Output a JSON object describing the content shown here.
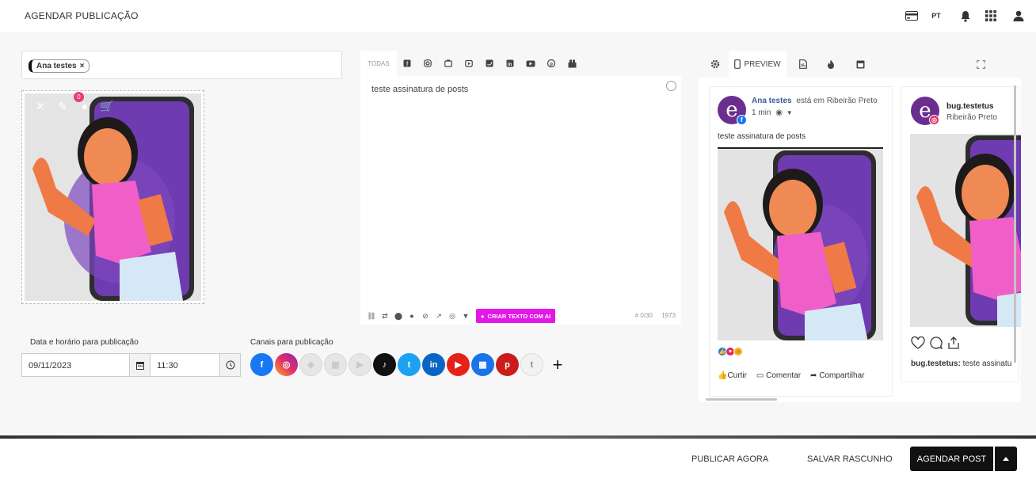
{
  "header": {
    "title": "AGENDAR PUBLICAÇÃO",
    "lang": "PT",
    "icons": [
      "credit-card-icon",
      "bell-icon",
      "apps-grid-icon",
      "user-icon"
    ]
  },
  "profile_tag": {
    "label": "Ana testes",
    "remove": "×"
  },
  "media": {
    "badge_count": "0",
    "tools": [
      "close-icon",
      "brush-icon",
      "person-icon",
      "cart-icon"
    ]
  },
  "schedule": {
    "label": "Data e horário para publicação",
    "date": "09/11/2023",
    "time": "11:30"
  },
  "channels": {
    "label": "Canais para publicação",
    "items": [
      {
        "name": "facebook",
        "glyph": "f",
        "color": "#1877f2",
        "enabled": true
      },
      {
        "name": "instagram",
        "glyph": "◎",
        "color": "#e1306c",
        "enabled": true
      },
      {
        "name": "google-business",
        "glyph": "◈",
        "color": "#e6e6e6",
        "enabled": false
      },
      {
        "name": "google-my-business",
        "glyph": "▣",
        "color": "#e6e6e6",
        "enabled": false
      },
      {
        "name": "youtube-shorts",
        "glyph": "▶",
        "color": "#e6e6e6",
        "enabled": false
      },
      {
        "name": "tiktok",
        "glyph": "♪",
        "color": "#111111",
        "enabled": true
      },
      {
        "name": "twitter",
        "glyph": "t",
        "color": "#1da1f2",
        "enabled": true
      },
      {
        "name": "linkedin",
        "glyph": "in",
        "color": "#0a66c2",
        "enabled": true
      },
      {
        "name": "youtube",
        "glyph": "▶",
        "color": "#e62117",
        "enabled": true
      },
      {
        "name": "gmb-store",
        "glyph": "▦",
        "color": "#1a73e8",
        "enabled": true
      },
      {
        "name": "pinterest",
        "glyph": "p",
        "color": "#cc1b1b",
        "enabled": true
      },
      {
        "name": "tumblr",
        "glyph": "t",
        "color": "#f2f2f2",
        "enabled": true
      }
    ],
    "add": "+"
  },
  "editor": {
    "tab_all": "TODAS",
    "content": "teste assinatura de posts",
    "ai_button": "CRIAR TEXTO COM AI",
    "counter": "# 0/30",
    "char_count": "1973"
  },
  "preview": {
    "tab_label": "PREVIEW",
    "facebook": {
      "name": "Ana testes",
      "location": "está em Ribeirão Preto",
      "time": "1 min",
      "text": "teste assinatura de posts",
      "like": "Curtir",
      "comment": "Comentar",
      "share": "Compartilhar"
    },
    "instagram": {
      "username": "bug.testetus",
      "location": "Ribeirão Preto",
      "caption_user": "bug.testetus:",
      "caption_text": "teste assinatu"
    }
  },
  "footer": {
    "publish_now": "PUBLICAR AGORA",
    "save_draft": "SALVAR RASCUNHO",
    "schedule_post": "AGENDAR POST"
  }
}
